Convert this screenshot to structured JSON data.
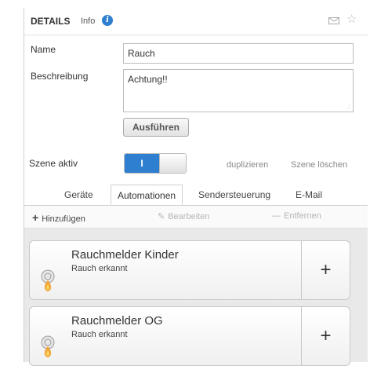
{
  "header": {
    "title": "DETAILS",
    "subtitle": "Info"
  },
  "form": {
    "name_label": "Name",
    "name_value": "Rauch",
    "description_label": "Beschreibung",
    "description_value": "Achtung!!",
    "execute_button": "Ausführen",
    "scene_active_label": "Szene aktiv",
    "toggle_on_text": "I",
    "toggle_state": "on",
    "duplicate_link": "duplizieren",
    "delete_scene_link": "Szene löschen"
  },
  "tabs": [
    {
      "label": "Geräte",
      "active": false
    },
    {
      "label": "Automationen",
      "active": true
    },
    {
      "label": "Sendersteuerung",
      "active": false
    },
    {
      "label": "E-Mail",
      "active": false
    }
  ],
  "toolbar": {
    "add_label": "Hinzufügen",
    "edit_label": "Bearbeiten",
    "remove_label": "Entfernen"
  },
  "automations": [
    {
      "title": "Rauchmelder Kinder",
      "status": "Rauch erkannt"
    },
    {
      "title": "Rauchmelder OG",
      "status": "Rauch erkannt"
    }
  ],
  "colors": {
    "accent": "#2f7fd0",
    "disabled_text": "#b5b5b5"
  },
  "icons": {
    "info": "info-icon",
    "mail": "mail-icon",
    "favorite": "star-icon",
    "smoke_detector": "smoke-detector-icon"
  }
}
